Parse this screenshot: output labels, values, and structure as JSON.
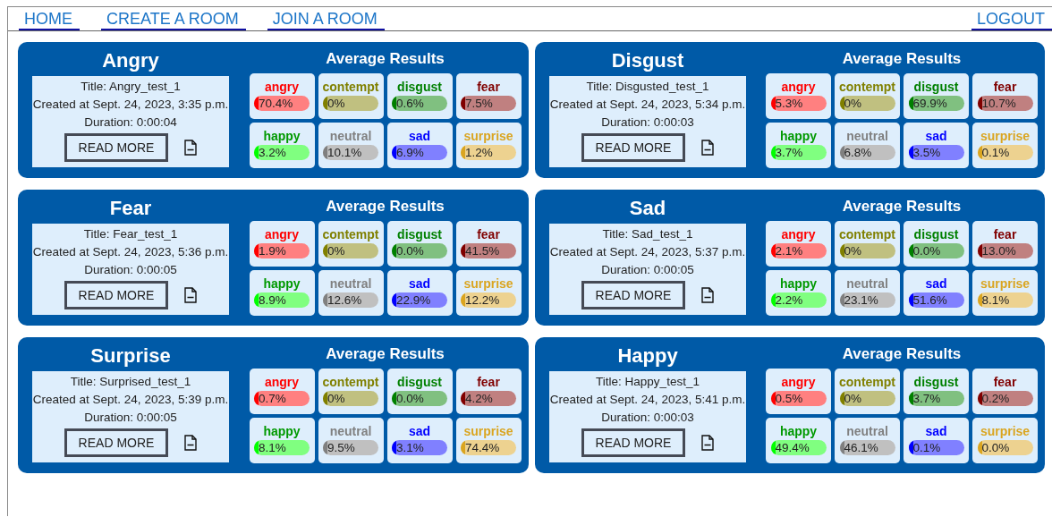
{
  "nav": {
    "links": [
      "HOME",
      "CREATE A ROOM",
      "JOIN A ROOM"
    ],
    "logout": "LOGOUT"
  },
  "cards": [
    {
      "emotion": "Angry",
      "title": "Title: Angry_test_1",
      "created": "Created at Sept. 24, 2023, 3:35 p.m.",
      "duration": "Duration: 0:00:04",
      "read_more": "READ MORE",
      "results_heading": "Average Results",
      "results": [
        {
          "label": "angry",
          "value": "70.4%",
          "color": "#ff0000"
        },
        {
          "label": "contempt",
          "value": "0%",
          "color": "#808000"
        },
        {
          "label": "disgust",
          "value": "0.6%",
          "color": "#008000"
        },
        {
          "label": "fear",
          "value": "7.5%",
          "color": "#800000"
        },
        {
          "label": "happy",
          "value": "3.2%",
          "color": "#00ff00"
        },
        {
          "label": "neutral",
          "value": "10.1%",
          "color": "#808080"
        },
        {
          "label": "sad",
          "value": "6.9%",
          "color": "#0000ff"
        },
        {
          "label": "surprise",
          "value": "1.2%",
          "color": "#daa520"
        }
      ]
    },
    {
      "emotion": "Disgust",
      "title": "Title: Disgusted_test_1",
      "created": "Created at Sept. 24, 2023, 5:34 p.m.",
      "duration": "Duration: 0:00:03",
      "read_more": "READ MORE",
      "results_heading": "Average Results",
      "results": [
        {
          "label": "angry",
          "value": "5.3%",
          "color": "#ff0000"
        },
        {
          "label": "contempt",
          "value": "0%",
          "color": "#808000"
        },
        {
          "label": "disgust",
          "value": "69.9%",
          "color": "#008000"
        },
        {
          "label": "fear",
          "value": "10.7%",
          "color": "#800000"
        },
        {
          "label": "happy",
          "value": "3.7%",
          "color": "#00ff00"
        },
        {
          "label": "neutral",
          "value": "6.8%",
          "color": "#808080"
        },
        {
          "label": "sad",
          "value": "3.5%",
          "color": "#0000ff"
        },
        {
          "label": "surprise",
          "value": "0.1%",
          "color": "#daa520"
        }
      ]
    },
    {
      "emotion": "Fear",
      "title": "Title: Fear_test_1",
      "created": "Created at Sept. 24, 2023, 5:36 p.m.",
      "duration": "Duration: 0:00:05",
      "read_more": "READ MORE",
      "results_heading": "Average Results",
      "results": [
        {
          "label": "angry",
          "value": "1.9%",
          "color": "#ff0000"
        },
        {
          "label": "contempt",
          "value": "0%",
          "color": "#808000"
        },
        {
          "label": "disgust",
          "value": "0.0%",
          "color": "#008000"
        },
        {
          "label": "fear",
          "value": "41.5%",
          "color": "#800000"
        },
        {
          "label": "happy",
          "value": "8.9%",
          "color": "#00ff00"
        },
        {
          "label": "neutral",
          "value": "12.6%",
          "color": "#808080"
        },
        {
          "label": "sad",
          "value": "22.9%",
          "color": "#0000ff"
        },
        {
          "label": "surprise",
          "value": "12.2%",
          "color": "#daa520"
        }
      ]
    },
    {
      "emotion": "Sad",
      "title": "Title: Sad_test_1",
      "created": "Created at Sept. 24, 2023, 5:37 p.m.",
      "duration": "Duration: 0:00:05",
      "read_more": "READ MORE",
      "results_heading": "Average Results",
      "results": [
        {
          "label": "angry",
          "value": "2.1%",
          "color": "#ff0000"
        },
        {
          "label": "contempt",
          "value": "0%",
          "color": "#808000"
        },
        {
          "label": "disgust",
          "value": "0.0%",
          "color": "#008000"
        },
        {
          "label": "fear",
          "value": "13.0%",
          "color": "#800000"
        },
        {
          "label": "happy",
          "value": "2.2%",
          "color": "#00ff00"
        },
        {
          "label": "neutral",
          "value": "23.1%",
          "color": "#808080"
        },
        {
          "label": "sad",
          "value": "51.6%",
          "color": "#0000ff"
        },
        {
          "label": "surprise",
          "value": "8.1%",
          "color": "#daa520"
        }
      ]
    },
    {
      "emotion": "Surprise",
      "title": "Title: Surprised_test_1",
      "created": "Created at Sept. 24, 2023, 5:39 p.m.",
      "duration": "Duration: 0:00:05",
      "read_more": "READ MORE",
      "results_heading": "Average Results",
      "results": [
        {
          "label": "angry",
          "value": "0.7%",
          "color": "#ff0000"
        },
        {
          "label": "contempt",
          "value": "0%",
          "color": "#808000"
        },
        {
          "label": "disgust",
          "value": "0.0%",
          "color": "#008000"
        },
        {
          "label": "fear",
          "value": "4.2%",
          "color": "#800000"
        },
        {
          "label": "happy",
          "value": "8.1%",
          "color": "#00ff00"
        },
        {
          "label": "neutral",
          "value": "9.5%",
          "color": "#808080"
        },
        {
          "label": "sad",
          "value": "3.1%",
          "color": "#0000ff"
        },
        {
          "label": "surprise",
          "value": "74.4%",
          "color": "#daa520"
        }
      ]
    },
    {
      "emotion": "Happy",
      "title": "Title: Happy_test_1",
      "created": "Created at Sept. 24, 2023, 5:41 p.m.",
      "duration": "Duration: 0:00:03",
      "read_more": "READ MORE",
      "results_heading": "Average Results",
      "results": [
        {
          "label": "angry",
          "value": "0.5%",
          "color": "#ff0000"
        },
        {
          "label": "contempt",
          "value": "0%",
          "color": "#808000"
        },
        {
          "label": "disgust",
          "value": "3.7%",
          "color": "#008000"
        },
        {
          "label": "fear",
          "value": "0.2%",
          "color": "#800000"
        },
        {
          "label": "happy",
          "value": "49.4%",
          "color": "#00ff00"
        },
        {
          "label": "neutral",
          "value": "46.1%",
          "color": "#808080"
        },
        {
          "label": "sad",
          "value": "0.1%",
          "color": "#0000ff"
        },
        {
          "label": "surprise",
          "value": "0.0%",
          "color": "#daa520"
        }
      ]
    }
  ]
}
